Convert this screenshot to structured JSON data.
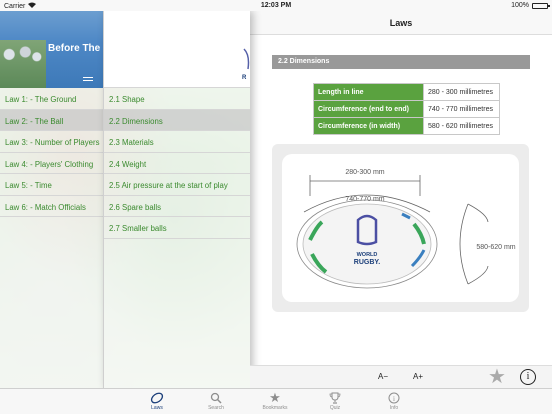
{
  "status": {
    "carrier": "Carrier",
    "time": "12:03 PM",
    "battery": "100%"
  },
  "banner": {
    "title": "Before The"
  },
  "laws": [
    {
      "label": "Law 1: - The Ground"
    },
    {
      "label": "Law 2: - The Ball"
    },
    {
      "label": "Law 3: - Number of Players"
    },
    {
      "label": "Law 4: - Players' Clothing"
    },
    {
      "label": "Law 5: - Time"
    },
    {
      "label": "Law 6: - Match Officials"
    }
  ],
  "sections": [
    {
      "label": "2.1 Shape"
    },
    {
      "label": "2.2 Dimensions"
    },
    {
      "label": "2.3 Materials"
    },
    {
      "label": "2.4 Weight"
    },
    {
      "label": "2.5 Air pressure at the start of play"
    },
    {
      "label": "2.6 Spare balls"
    },
    {
      "label": "2.7 Smaller balls"
    }
  ],
  "content": {
    "nav_title": "Laws",
    "section_header": "2.2 Dimensions",
    "table": [
      {
        "key": "Length in line",
        "value": "280 - 300 millimetres"
      },
      {
        "key": "Circumference (end to end)",
        "value": "740 - 770 millimetres"
      },
      {
        "key": "Circumference (in width)",
        "value": "580 - 620 millimetres"
      }
    ],
    "diagram": {
      "length_label": "280-300 mm",
      "circumference_label": "740-770 mm",
      "width_label": "580-620 mm",
      "ball_text_1": "WORLD",
      "ball_text_2": "RUGBY."
    }
  },
  "toolbar": {
    "font_decrease": "A−",
    "font_increase": "A+",
    "bookmark_icon": "star-icon",
    "info_icon": "info-icon",
    "info_glyph": "i"
  },
  "tabs": [
    {
      "label": "Laws",
      "icon": "rugby-ball-icon"
    },
    {
      "label": "Search",
      "icon": "magnifier-icon"
    },
    {
      "label": "Bookmarks",
      "icon": "star-icon"
    },
    {
      "label": "Quiz",
      "icon": "trophy-icon"
    },
    {
      "label": "Info",
      "icon": "info-icon"
    }
  ],
  "colors": {
    "accent_green": "#5aa23f",
    "link_green": "#3a8a2e",
    "tab_active": "#1c3f7a"
  }
}
